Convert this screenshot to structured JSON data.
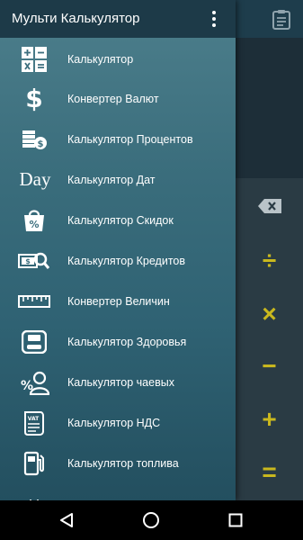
{
  "drawer": {
    "title": "Мульти Калькулятор",
    "items": [
      {
        "label": "Калькулятор",
        "icon": "calculator-icon"
      },
      {
        "label": "Конвертер Валют",
        "icon": "dollar-icon"
      },
      {
        "label": "Калькулятор Процентов",
        "icon": "coins-percent-icon"
      },
      {
        "label": "Калькулятор Дат",
        "icon": "day-icon",
        "icon_text": "Day"
      },
      {
        "label": "Калькулятор Скидок",
        "icon": "discount-bag-icon"
      },
      {
        "label": "Калькулятор Кредитов",
        "icon": "loan-icon"
      },
      {
        "label": "Конвертер Величин",
        "icon": "ruler-icon"
      },
      {
        "label": "Калькулятор Здоровья",
        "icon": "scale-icon"
      },
      {
        "label": "Калькулятор чаевых",
        "icon": "tip-icon"
      },
      {
        "label": "Калькулятор НДС",
        "icon": "vat-icon",
        "icon_text": "VAT"
      },
      {
        "label": "Калькулятор топлива",
        "icon": "fuel-icon"
      },
      {
        "label": "",
        "icon": "partial-icon"
      }
    ]
  },
  "keypad": {
    "keys": [
      "÷",
      "×",
      "−",
      "+",
      "="
    ]
  },
  "colors": {
    "accent": "#c9b81e",
    "drawer_header": "#1d3a48"
  }
}
